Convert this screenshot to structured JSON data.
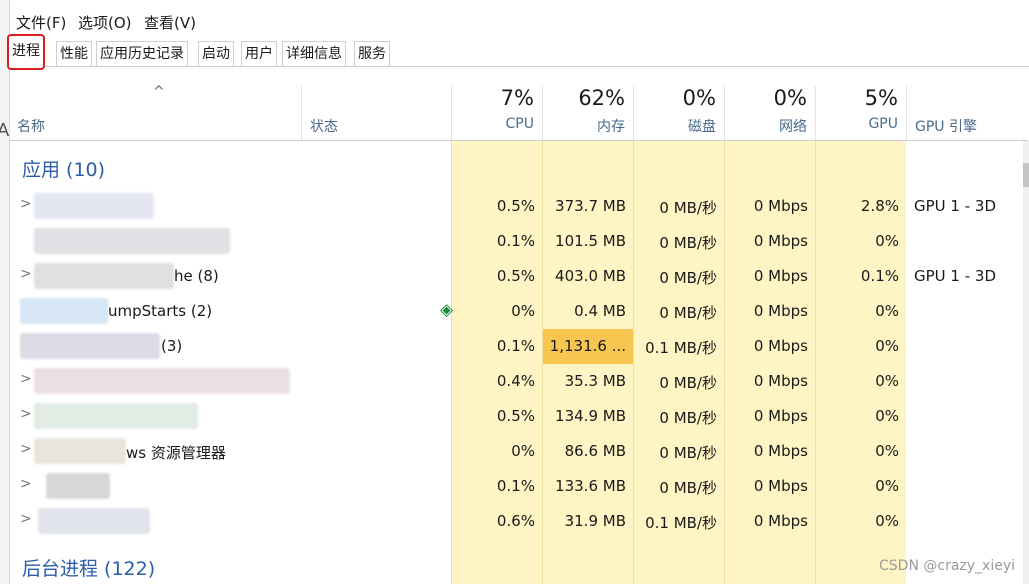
{
  "menu": [
    "文件(F)",
    "选项(O)",
    "查看(V)"
  ],
  "tabs": [
    "进程",
    "性能",
    "应用历史记录",
    "启动",
    "用户",
    "详细信息",
    "服务"
  ],
  "columns": {
    "name": "名称",
    "status": "状态",
    "cpu": {
      "pct": "7%",
      "label": "CPU"
    },
    "mem": {
      "pct": "62%",
      "label": "内存"
    },
    "disk": {
      "pct": "0%",
      "label": "磁盘"
    },
    "net": {
      "pct": "0%",
      "label": "网络"
    },
    "gpu": {
      "pct": "5%",
      "label": "GPU"
    },
    "gpu_engine": "GPU 引擎"
  },
  "groups": {
    "apps": "应用 (10)",
    "background": "后台进程 (122)"
  },
  "rows": [
    {
      "name": "",
      "cpu": "0.5%",
      "mem": "373.7 MB",
      "disk": "0 MB/秒",
      "net": "0 Mbps",
      "gpu": "2.8%",
      "engine": "GPU 1 - 3D"
    },
    {
      "name": "",
      "cpu": "0.1%",
      "mem": "101.5 MB",
      "disk": "0 MB/秒",
      "net": "0 Mbps",
      "gpu": "0%",
      "engine": ""
    },
    {
      "name": "he (8)",
      "cpu": "0.5%",
      "mem": "403.0 MB",
      "disk": "0 MB/秒",
      "net": "0 Mbps",
      "gpu": "0.1%",
      "engine": "GPU 1 - 3D"
    },
    {
      "name": "umpStarts (2)",
      "cpu": "0%",
      "mem": "0.4 MB",
      "disk": "0 MB/秒",
      "net": "0 Mbps",
      "gpu": "0%",
      "engine": ""
    },
    {
      "name": "(3)",
      "cpu": "0.1%",
      "mem": "1,131.6 ...",
      "disk": "0.1 MB/秒",
      "net": "0 Mbps",
      "gpu": "0%",
      "engine": ""
    },
    {
      "name": "",
      "cpu": "0.4%",
      "mem": "35.3 MB",
      "disk": "0 MB/秒",
      "net": "0 Mbps",
      "gpu": "0%",
      "engine": ""
    },
    {
      "name": "",
      "cpu": "0.5%",
      "mem": "134.9 MB",
      "disk": "0 MB/秒",
      "net": "0 Mbps",
      "gpu": "0%",
      "engine": ""
    },
    {
      "name": "ws 资源管理器",
      "cpu": "0%",
      "mem": "86.6 MB",
      "disk": "0 MB/秒",
      "net": "0 Mbps",
      "gpu": "0%",
      "engine": ""
    },
    {
      "name": "",
      "cpu": "0.1%",
      "mem": "133.6 MB",
      "disk": "0 MB/秒",
      "net": "0 Mbps",
      "gpu": "0%",
      "engine": ""
    },
    {
      "name": "",
      "cpu": "0.6%",
      "mem": "31.9 MB",
      "disk": "0.1 MB/秒",
      "net": "0 Mbps",
      "gpu": "0%",
      "engine": ""
    }
  ],
  "watermark": "CSDN @crazy_xieyi",
  "colors": {
    "heat_light": "#fff4c4",
    "heat_hot": "#f7c651",
    "group_blue": "#2a5da8",
    "active_tab_border": "#e01b1b"
  }
}
